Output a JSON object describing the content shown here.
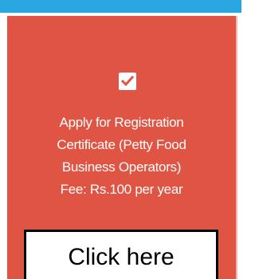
{
  "accent_colors": {
    "top_bar": "#2aa7e0",
    "card": "#e05444",
    "text": "#ffffff",
    "button_bg": "#ffffff",
    "button_border": "#000000"
  },
  "card": {
    "icon": "check-square-icon",
    "title_lines": [
      "Apply for Registration",
      "Certificate (Petty Food",
      "Business Operators)",
      "Fee: Rs.100 per year"
    ],
    "button_label": "Click here"
  }
}
